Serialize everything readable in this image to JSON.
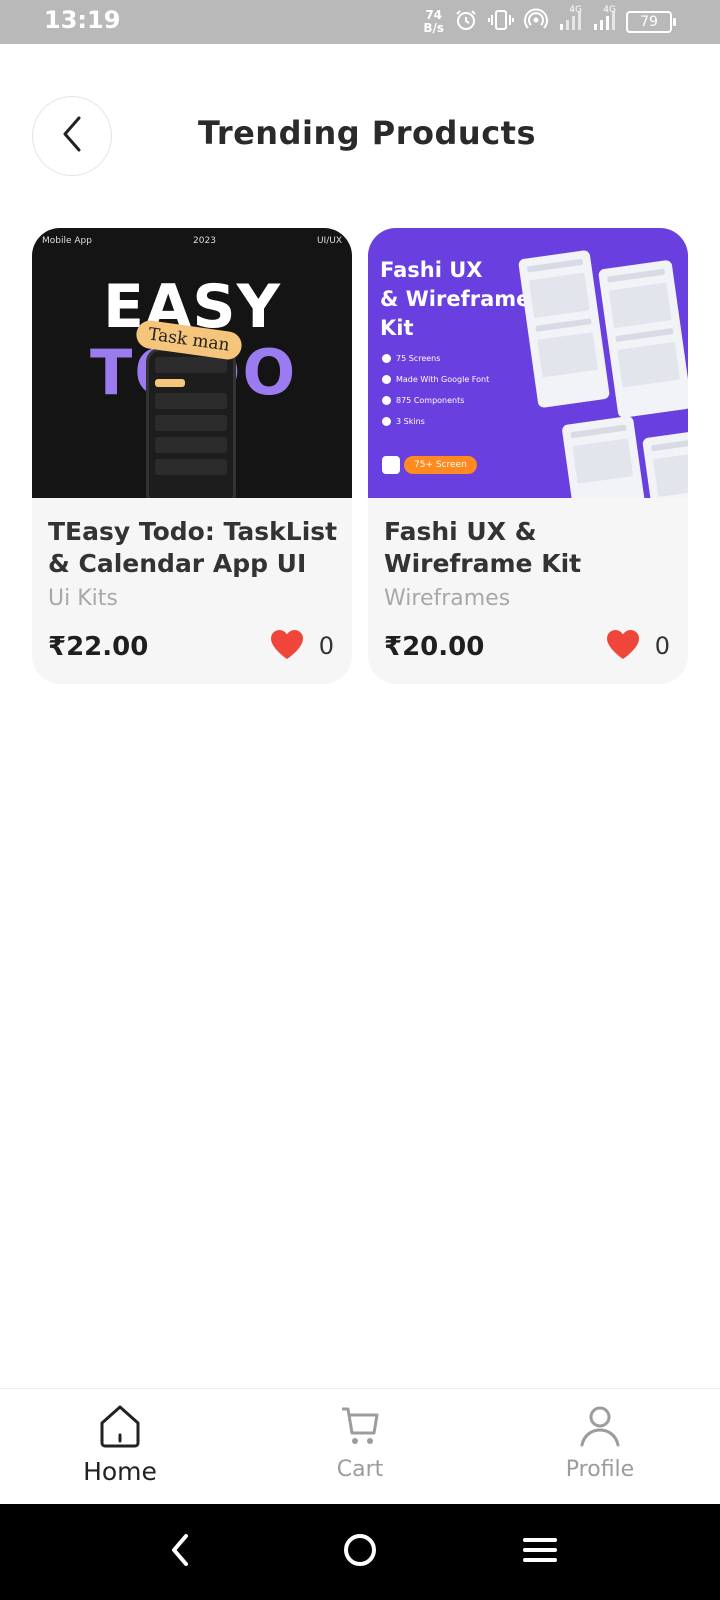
{
  "status_bar": {
    "time": "13:19",
    "net_speed_value": "74",
    "net_speed_unit": "B/s",
    "sim1": "4G",
    "sim2": "4G",
    "battery": "79"
  },
  "header": {
    "title": "Trending Products",
    "back_icon": "chevron-left-icon"
  },
  "products": [
    {
      "thumb": {
        "top_left": "Mobile App",
        "top_center": "2023",
        "top_right": "UI/UX",
        "line1": "EASY",
        "line2": "TODO",
        "tag": "Task man"
      },
      "title": "TEasy Todo: TaskList & Calendar App UI ...",
      "category": "Ui Kits",
      "price": "₹22.00",
      "likes": "0"
    },
    {
      "thumb": {
        "headline_1": "Fashi UX",
        "headline_2": "& Wireframe",
        "headline_3": "Kit",
        "features": [
          "75 Screens",
          "Made With Google Font",
          "875 Components",
          "3 Skins"
        ],
        "pill": "75+ Screen"
      },
      "title": "Fashi UX & Wireframe Kit",
      "category": "Wireframes",
      "price": "₹20.00",
      "likes": "0"
    }
  ],
  "bottom_nav": {
    "home": "Home",
    "cart": "Cart",
    "profile": "Profile"
  },
  "colors": {
    "heart": "#f0453a",
    "status_bar": "#b9b9b9",
    "card_bg": "#f6f6f6",
    "accent_purple": "#6a3fe0"
  }
}
